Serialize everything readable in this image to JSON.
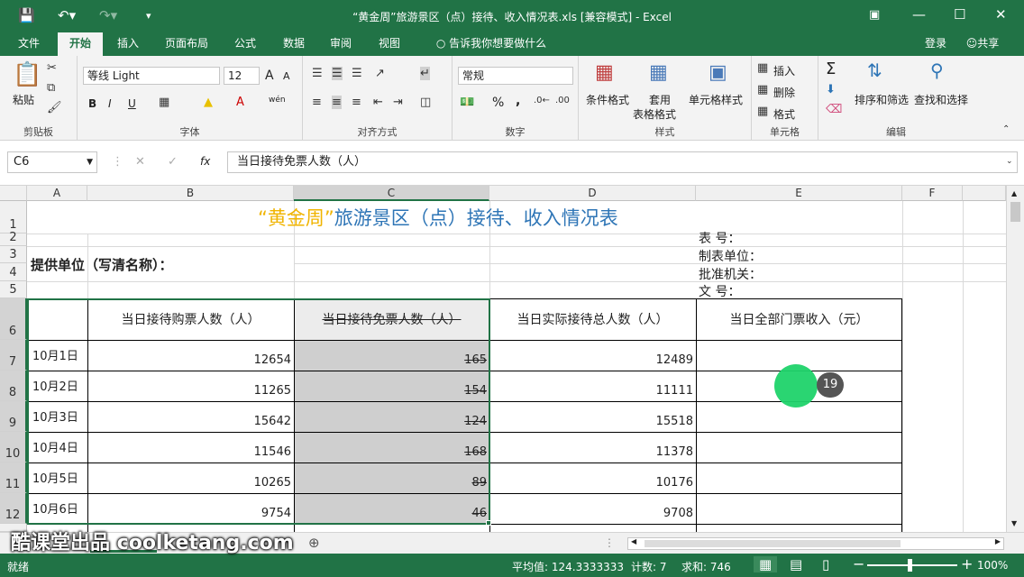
{
  "window": {
    "title": "“黄金周”旅游景区（点）接待、收入情况表.xls  [兼容模式] - Excel",
    "login": "登录",
    "share": "共享"
  },
  "tabs": [
    "文件",
    "开始",
    "插入",
    "页面布局",
    "公式",
    "数据",
    "审阅",
    "视图"
  ],
  "tell_me": "告诉我你想要做什么",
  "ribbon": {
    "clipboard": {
      "paste": "粘贴",
      "label": "剪贴板"
    },
    "font": {
      "name": "等线 Light",
      "size": "12",
      "label": "字体",
      "bold": "B",
      "italic": "I",
      "underline": "U",
      "grow": "A",
      "shrink": "A",
      "wen": "wén"
    },
    "alignment": {
      "label": "对齐方式"
    },
    "number": {
      "format": "常规",
      "label": "数字",
      "percent": "%",
      "comma": ","
    },
    "styles": {
      "conditional": "条件格式",
      "table": "套用",
      "table2": "表格格式",
      "cell": "单元格样式",
      "label": "样式"
    },
    "cells": {
      "insert": "插入",
      "delete": "删除",
      "format": "格式",
      "label": "单元格"
    },
    "editing": {
      "sort": "排序和筛选",
      "find": "查找和选择",
      "label": "编辑",
      "sigma": "Σ"
    }
  },
  "formula_bar": {
    "name_box": "C6",
    "fx": "fx",
    "content": "当日接待免票人数（人）"
  },
  "columns": [
    "A",
    "B",
    "C",
    "D",
    "E",
    "F"
  ],
  "rows": [
    "1",
    "2",
    "3",
    "4",
    "5",
    "6",
    "7",
    "8",
    "9",
    "10",
    "11",
    "12"
  ],
  "sheet": {
    "title_quote": "“黄金周”",
    "title_rest": "旅游景区（点）接待、收入情况表",
    "provider": "提供单位（写清名称）：",
    "meta": [
      "表      号：",
      "制表单位：",
      "批准机关：",
      "文      号："
    ],
    "headers": {
      "b": "当日接待购票人数（人）",
      "c": "当日接待免票人数（人）",
      "d": "当日实际接待总人数（人）",
      "e": "当日全部门票收入（元）"
    },
    "data": [
      {
        "date": "10月1日",
        "b": "12654",
        "c": "165",
        "d": "12489"
      },
      {
        "date": "10月2日",
        "b": "11265",
        "c": "154",
        "d": "11111"
      },
      {
        "date": "10月3日",
        "b": "15642",
        "c": "124",
        "d": "15518"
      },
      {
        "date": "10月4日",
        "b": "11546",
        "c": "168",
        "d": "11378"
      },
      {
        "date": "10月5日",
        "b": "10265",
        "c": "89",
        "d": "10176"
      },
      {
        "date": "10月6日",
        "b": "9754",
        "c": "46",
        "d": "9708"
      }
    ]
  },
  "status": {
    "ready": "就绪",
    "average": "平均值: 124.3333333",
    "count": "计数: 7",
    "sum": "求和: 746",
    "zoom": "100%"
  },
  "watermark": "酷课堂出品 coolketang.com",
  "badge": "19",
  "colors": {
    "brand": "#217346",
    "selection": "#cfcfcf",
    "title_quote": "#f0b400",
    "title_text": "#2e75b6"
  }
}
